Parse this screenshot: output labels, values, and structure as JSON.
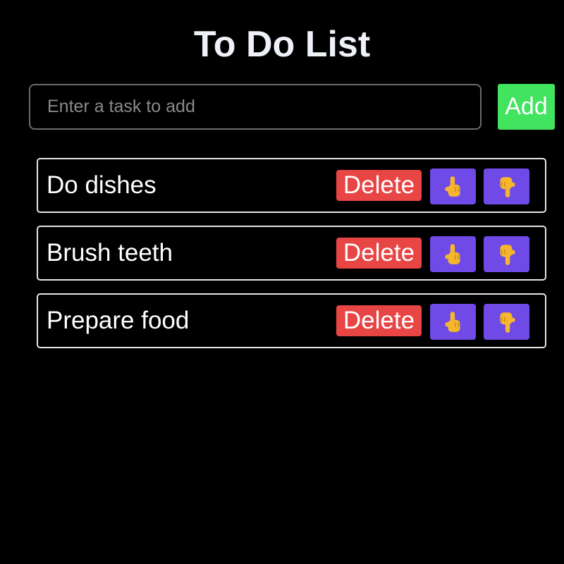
{
  "header": {
    "title": "To Do List"
  },
  "input": {
    "placeholder": "Enter a task to add",
    "value": ""
  },
  "add_button": {
    "label": "Add"
  },
  "tasks": [
    {
      "text": "Do dishes",
      "delete_label": "Delete",
      "up_icon": "hand-pointing-up-icon",
      "down_icon": "hand-pointing-down-icon"
    },
    {
      "text": "Brush teeth",
      "delete_label": "Delete",
      "up_icon": "hand-pointing-up-icon",
      "down_icon": "hand-pointing-down-icon"
    },
    {
      "text": "Prepare food",
      "delete_label": "Delete",
      "up_icon": "hand-pointing-up-icon",
      "down_icon": "hand-pointing-down-icon"
    }
  ],
  "colors": {
    "background": "#000000",
    "add_button": "#41e35f",
    "delete_button": "#e84545",
    "move_button": "#6f4ae6",
    "hand_icon": "#f5b62e"
  }
}
